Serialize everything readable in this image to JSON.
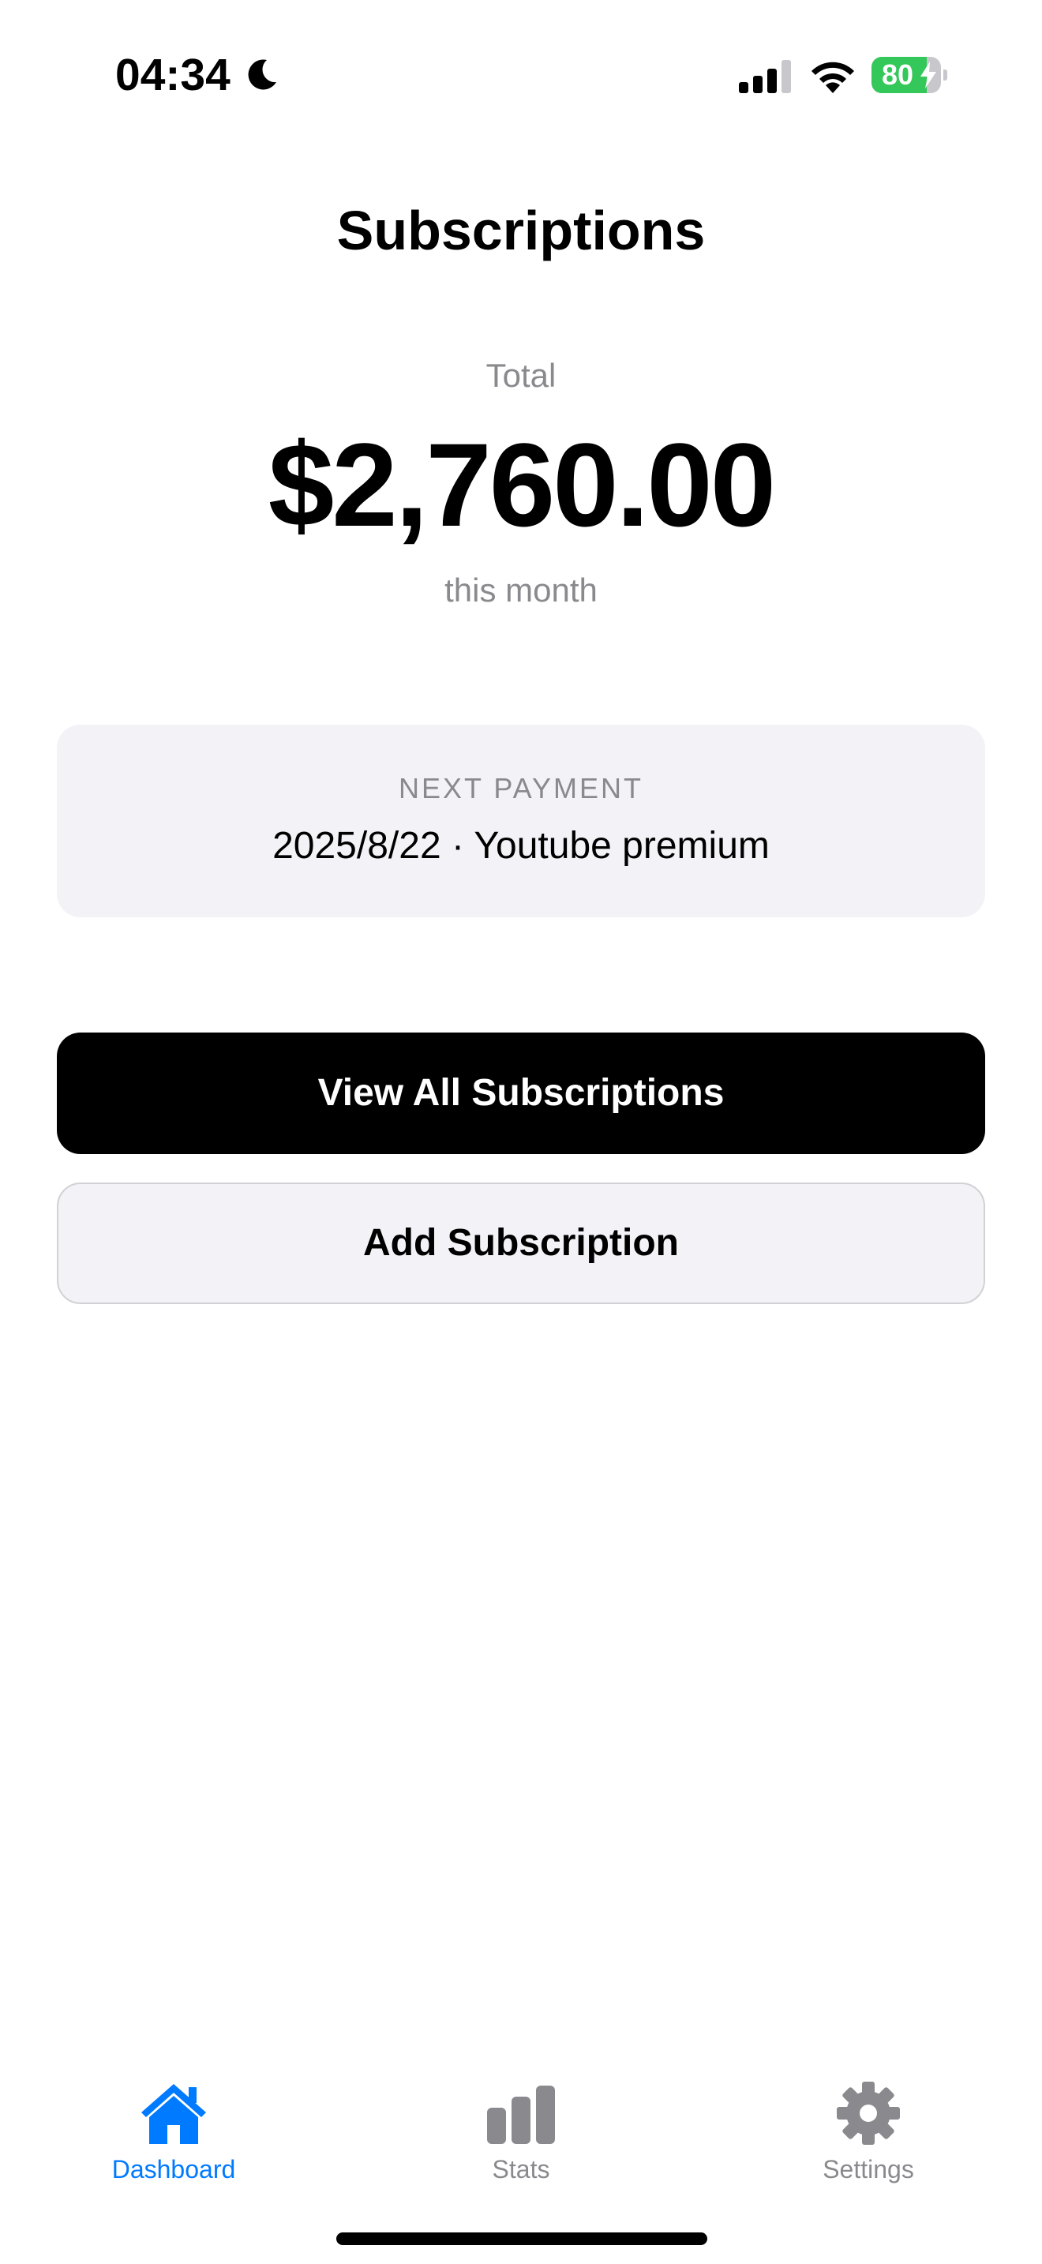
{
  "status_bar": {
    "time": "04:34",
    "focus_icon": "moon-icon",
    "signal_icon": "cellular-signal-icon",
    "wifi_icon": "wifi-icon",
    "battery_percent": "80",
    "battery_level": 0.8,
    "battery_charging": true
  },
  "header": {
    "title": "Subscriptions"
  },
  "summary": {
    "total_label": "Total",
    "total_amount": "$2,760.00",
    "period_label": "this month"
  },
  "next_payment": {
    "label": "NEXT PAYMENT",
    "value": "2025/8/22 · Youtube premium"
  },
  "actions": {
    "view_all_label": "View All Subscriptions",
    "add_label": "Add Subscription"
  },
  "tab_bar": {
    "active": "Dashboard",
    "accent_color": "#007aff",
    "inactive_color": "#8a8a8e",
    "items": [
      {
        "label": "Dashboard",
        "icon": "house-icon"
      },
      {
        "label": "Stats",
        "icon": "bar-chart-icon"
      },
      {
        "label": "Settings",
        "icon": "gear-icon"
      }
    ]
  }
}
